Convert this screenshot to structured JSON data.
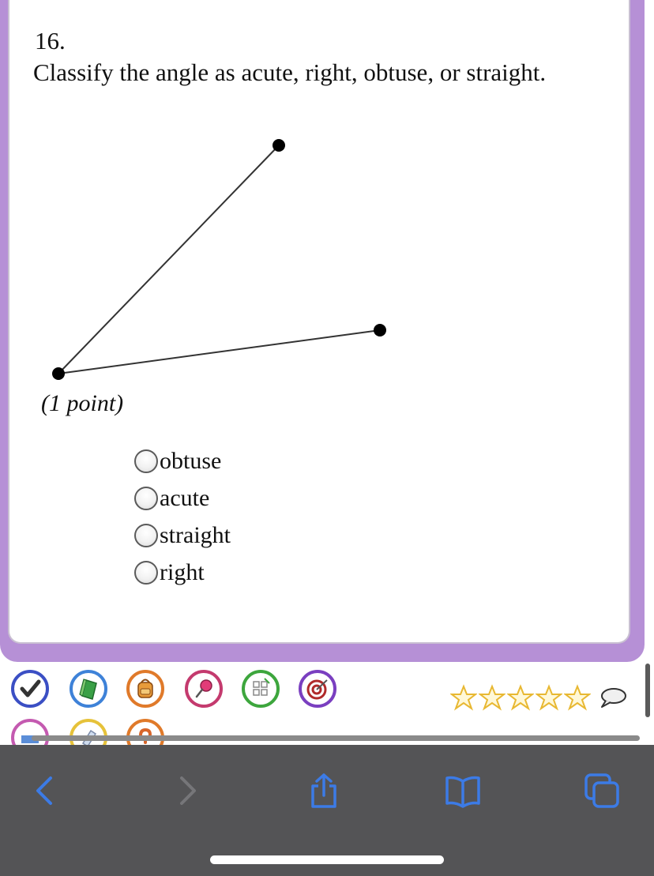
{
  "question": {
    "number": "16.",
    "prompt": "Classify the angle as acute, right, obtuse, or straight.",
    "points": "(1 point)",
    "choices": [
      {
        "label": "obtuse"
      },
      {
        "label": "acute"
      },
      {
        "label": "straight"
      },
      {
        "label": "right"
      }
    ]
  },
  "tools": {
    "row1": [
      "checkmark-icon",
      "book-icon",
      "backpack-icon",
      "pushpin-icon",
      "grid-tool-icon",
      "target-icon"
    ],
    "row2": [
      "eraser-icon",
      "notepad-icon",
      "help-icon"
    ]
  },
  "rating": {
    "stars_filled": 0,
    "stars_total": 5
  },
  "colors": {
    "card_border": "#b690d6",
    "toolbar_bg": "#545456",
    "toolbar_icon": "#3c7be6",
    "toolbar_icon_disabled": "#767679",
    "star": "#f5c842"
  },
  "browser_toolbar": {
    "buttons": [
      "back-icon",
      "forward-icon",
      "share-icon",
      "bookmarks-icon",
      "tabs-icon"
    ]
  }
}
